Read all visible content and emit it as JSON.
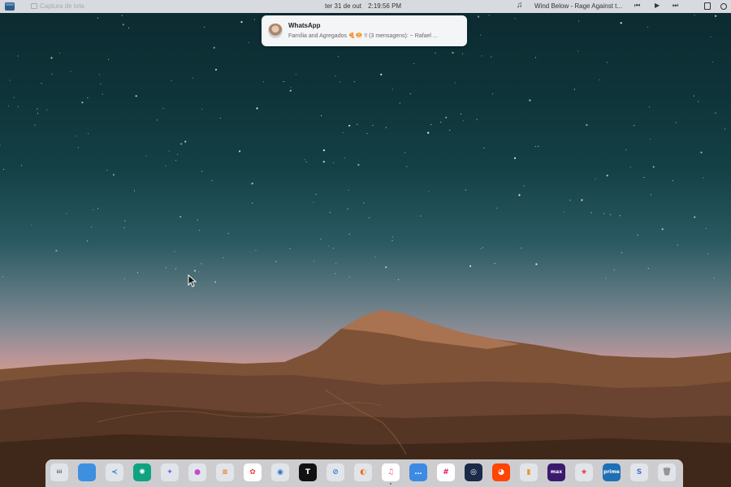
{
  "topbar": {
    "app_name": "Captura de tela",
    "date": "ter 31 de out",
    "time": "2:19:56 PM",
    "track": "Wind Below - Rage Against t...",
    "prev_symbol": "⏮",
    "play_symbol": "▶",
    "next_symbol": "⏭"
  },
  "notification": {
    "app": "WhatsApp",
    "message": "Família and Agregados 🍕🥯 !! (3 mensagens): ~ Rafael ..."
  },
  "dock": {
    "items": [
      {
        "name": "app-grid",
        "glyph": "⁞⁞⁞",
        "color": "#e1e4e8",
        "fg": "#444"
      },
      {
        "name": "files",
        "glyph": "",
        "color": "#3d8fe0",
        "fg": "#fff"
      },
      {
        "name": "vscode",
        "glyph": "≺",
        "color": "#e1e4e8",
        "fg": "#1f7fd4"
      },
      {
        "name": "chatgpt",
        "glyph": "✺",
        "color": "#10a37f",
        "fg": "#fff"
      },
      {
        "name": "gemini",
        "glyph": "✦",
        "color": "#e1e4e8",
        "fg": "#7b5cf0"
      },
      {
        "name": "color-picker",
        "glyph": "●",
        "color": "#e1e4e8",
        "fg": "#c04ad0"
      },
      {
        "name": "layers",
        "glyph": "≋",
        "color": "#e1e4e8",
        "fg": "#e07b2a"
      },
      {
        "name": "google-photos",
        "glyph": "✿",
        "color": "#ffffff",
        "fg": "#e8453c"
      },
      {
        "name": "thunderbird",
        "glyph": "◉",
        "color": "#e1e4e8",
        "fg": "#2e74c9"
      },
      {
        "name": "typora",
        "glyph": "T",
        "color": "#111111",
        "fg": "#fff"
      },
      {
        "name": "safari",
        "glyph": "⊘",
        "color": "#e1e4e8",
        "fg": "#3a7ad6"
      },
      {
        "name": "firefox",
        "glyph": "◐",
        "color": "#e1e4e8",
        "fg": "#f3701f"
      },
      {
        "name": "music",
        "glyph": "♫",
        "color": "#ffffff",
        "fg": "#f0506e"
      },
      {
        "name": "chat",
        "glyph": "…",
        "color": "#3c8ae4",
        "fg": "#fff"
      },
      {
        "name": "slack",
        "glyph": "#",
        "color": "#ffffff",
        "fg": "#e01e5a"
      },
      {
        "name": "steam",
        "glyph": "◎",
        "color": "#1b2a48",
        "fg": "#fff"
      },
      {
        "name": "reddit",
        "glyph": "◕",
        "color": "#ff4500",
        "fg": "#fff"
      },
      {
        "name": "notes",
        "glyph": "▮",
        "color": "#e1e4e8",
        "fg": "#e59a2b"
      },
      {
        "name": "hbo-max",
        "glyph": "max",
        "color": "#3b1a6e",
        "fg": "#fff"
      },
      {
        "name": "star",
        "glyph": "★",
        "color": "#e1e4e8",
        "fg": "#e83d4a"
      },
      {
        "name": "prime-video",
        "glyph": "prime",
        "color": "#1f6fb5",
        "fg": "#fff"
      },
      {
        "name": "software",
        "glyph": "S",
        "color": "#e1e4e8",
        "fg": "#4a6fd1"
      },
      {
        "name": "trash",
        "glyph": "🗑",
        "color": "#e1e4e8",
        "fg": "#888"
      }
    ]
  }
}
